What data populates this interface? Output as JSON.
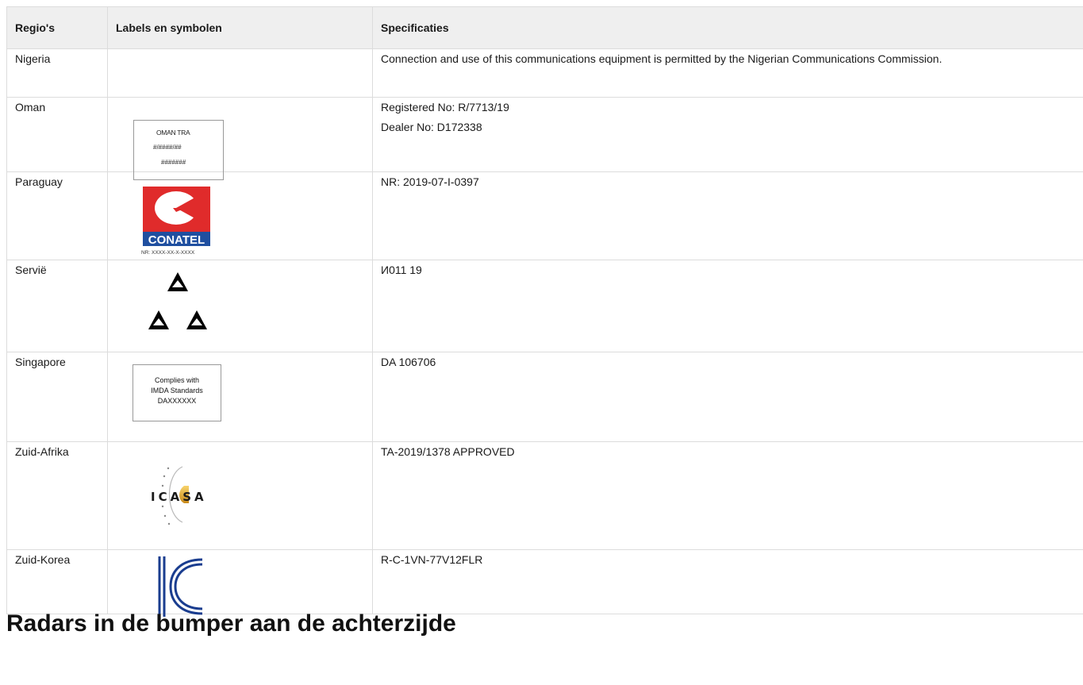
{
  "table": {
    "headers": {
      "region": "Regio's",
      "labels": "Labels en symbolen",
      "specs": "Specificaties"
    },
    "rows": {
      "nigeria": {
        "region": "Nigeria",
        "spec": "Connection and use of this communications equipment is permitted by the Nigerian Communications Commission."
      },
      "oman": {
        "region": "Oman",
        "spec_line1": "Registered No: R/7713/19",
        "spec_line2": "Dealer No: D172338",
        "label_line1": "OMAN TRA",
        "label_line2": "#/####/##",
        "label_line3": "#######"
      },
      "paraguay": {
        "region": "Paraguay",
        "spec": "NR: 2019-07-I-0397",
        "logo_text": "CONATEL",
        "label_nr": "NR: XXXX-XX-X-XXXX"
      },
      "serbia": {
        "region": "Servië",
        "spec": "И011 19"
      },
      "singapore": {
        "region": "Singapore",
        "spec": "DA 106706",
        "label_line1": "Complies with",
        "label_line2": "IMDA Standards",
        "label_line3": "DAXXXXXX"
      },
      "south_africa": {
        "region": "Zuid-Afrika",
        "spec": "TA-2019/1378 APPROVED",
        "logo_text": "ICASA"
      },
      "south_korea": {
        "region": "Zuid-Korea",
        "spec": "R-C-1VN-77V12FLR"
      }
    }
  },
  "overlay_heading": "Radars in de bumper aan de achterzijde",
  "colors": {
    "conatel_red": "#e02b2b",
    "conatel_blue": "#1f4fa0",
    "kc_blue": "#1a3d8f",
    "header_bg": "#efefef",
    "border": "#dcdcdc"
  }
}
